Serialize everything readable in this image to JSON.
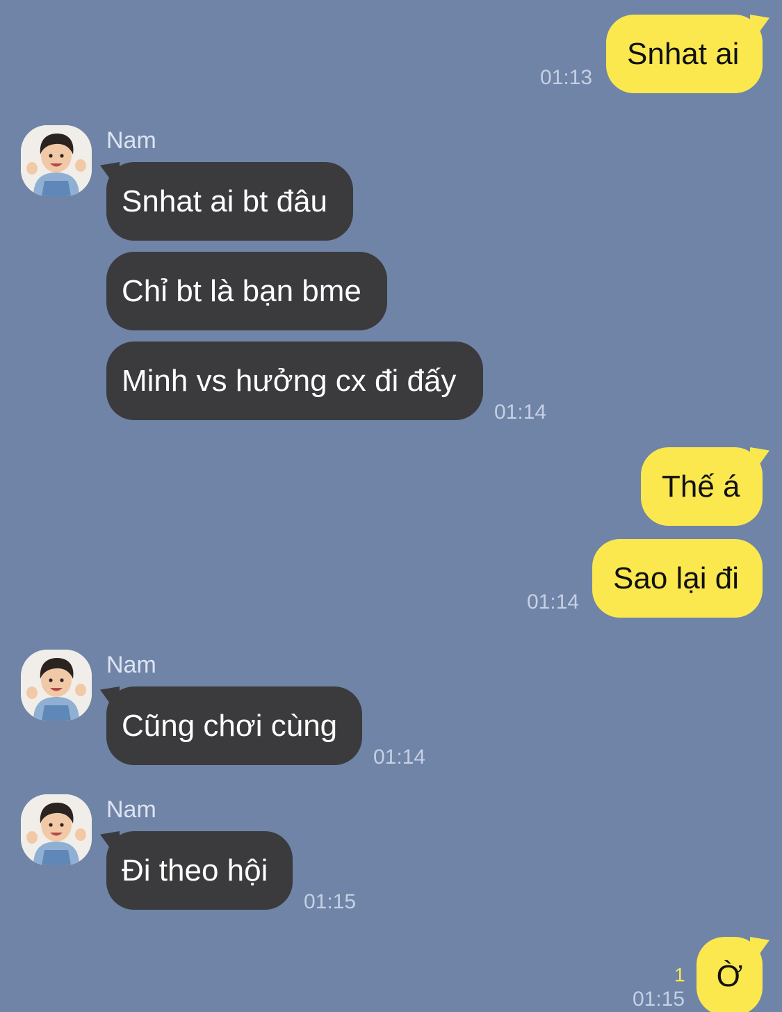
{
  "contact": {
    "name": "Nam",
    "avatar_icon": "child-avatar-icon"
  },
  "colors": {
    "background": "#6f84a7",
    "incoming_bubble": "#3b3b3d",
    "outgoing_bubble": "#fbe84f",
    "timestamp": "#c5d0e3",
    "unread": "#fbe84f"
  },
  "messages": [
    {
      "direction": "outgoing",
      "text": "Snhat ai",
      "time": "01:13"
    },
    {
      "direction": "incoming",
      "sender": "Nam",
      "text": "Snhat ai bt đâu"
    },
    {
      "direction": "incoming",
      "text": "Chỉ bt là bạn bme"
    },
    {
      "direction": "incoming",
      "text": "Minh vs hưởng cx đi đấy",
      "time": "01:14"
    },
    {
      "direction": "outgoing",
      "text": "Thế á"
    },
    {
      "direction": "outgoing",
      "text": "Sao lại đi",
      "time": "01:14"
    },
    {
      "direction": "incoming",
      "sender": "Nam",
      "text": "Cũng chơi cùng",
      "time": "01:14"
    },
    {
      "direction": "incoming",
      "sender": "Nam",
      "text": "Đi theo hội",
      "time": "01:15"
    },
    {
      "direction": "outgoing",
      "text": "Ờ",
      "time": "01:15",
      "unread_count": "1"
    }
  ]
}
